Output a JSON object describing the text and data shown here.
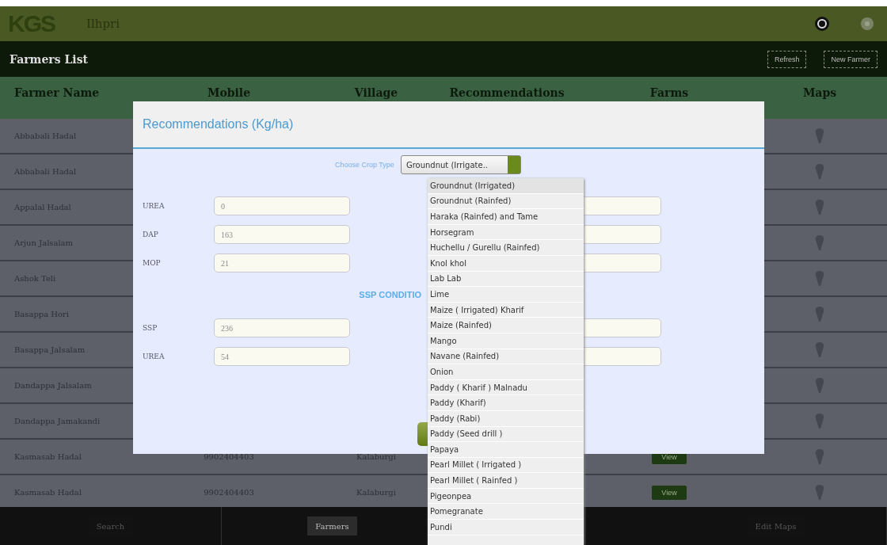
{
  "header": {
    "logo": "KGS",
    "title": "Ilhpri"
  },
  "toolbar": {
    "title": "Farmers List",
    "buttons": [
      "Refresh",
      "New Farmer"
    ]
  },
  "table": {
    "columns": [
      "Farmer Name",
      "Mobile",
      "Village",
      "Recommendations",
      "Farms",
      "Maps"
    ],
    "rows": [
      {
        "name": "Abbabali Hadal"
      },
      {
        "name": "Abbabali Hadal"
      },
      {
        "name": "Appalal Hadal"
      },
      {
        "name": "Arjun Jalsalam"
      },
      {
        "name": "Ashok Teli"
      },
      {
        "name": "Basappa Hori"
      },
      {
        "name": "Basappa Jalsalam"
      },
      {
        "name": "Dandappa Jalsalam"
      },
      {
        "name": "Dandappa Jamakandi"
      },
      {
        "name": "Kasmasab Hadal",
        "mobile": "9902404403",
        "village": "Kalaburgi",
        "farms": "View"
      },
      {
        "name": "Kasmasab Hadal",
        "mobile": "9902404403",
        "village": "Kalaburgi",
        "farms": "View"
      }
    ]
  },
  "modal": {
    "title": "Recommendations (Kg/ha)",
    "crop_label": "Choose Crop Type",
    "crop_value": "Groundnut (Irrigate..",
    "fields": [
      {
        "kind": "pair",
        "label": "UREA",
        "value": "0"
      },
      {
        "kind": "pair",
        "label": "DAP",
        "value": "163"
      },
      {
        "kind": "pair",
        "label": "MOP",
        "value": "21"
      },
      {
        "kind": "heading",
        "label": "SSP CONDITIO"
      },
      {
        "kind": "pair",
        "label": "SSP",
        "value": "236"
      },
      {
        "kind": "pair",
        "label": "UREA",
        "value": "54"
      }
    ]
  },
  "dropdown": [
    {
      "label": "Groundnut (Irrigated)",
      "selected": true
    },
    {
      "label": "Groundnut (Rainfed)",
      "selected": false
    },
    {
      "label": "Haraka (Rainfed) and Tame",
      "selected": false
    },
    {
      "label": "Horsegram",
      "selected": false
    },
    {
      "label": "Huchellu / Gurellu (Rainfed)",
      "selected": false
    },
    {
      "label": "Knol khol",
      "selected": false
    },
    {
      "label": "Lab Lab",
      "selected": false
    },
    {
      "label": "Lime",
      "selected": false
    },
    {
      "label": "Maize ( Irrigated) Kharif",
      "selected": false
    },
    {
      "label": "Maize (Rainfed)",
      "selected": false
    },
    {
      "label": "Mango",
      "selected": false
    },
    {
      "label": "Navane (Rainfed)",
      "selected": false
    },
    {
      "label": "Onion",
      "selected": false
    },
    {
      "label": "Paddy ( Kharif ) Malnadu",
      "selected": false
    },
    {
      "label": "Paddy (Kharif)",
      "selected": false
    },
    {
      "label": "Paddy (Rabi)",
      "selected": false
    },
    {
      "label": "Paddy (Seed drill )",
      "selected": false
    },
    {
      "label": "Papaya",
      "selected": false
    },
    {
      "label": "Pearl Millet ( Irrigated )",
      "selected": false
    },
    {
      "label": "Pearl Millet ( Rainfed )",
      "selected": false
    },
    {
      "label": "Pigeonpea",
      "selected": false
    },
    {
      "label": "Pomegranate",
      "selected": false
    },
    {
      "label": "Pundi",
      "selected": false
    }
  ],
  "nav": [
    {
      "label": "Search",
      "selected": false
    },
    {
      "label": "Farmers",
      "selected": true
    },
    {
      "label": "Edit Maps",
      "selected": false
    }
  ]
}
